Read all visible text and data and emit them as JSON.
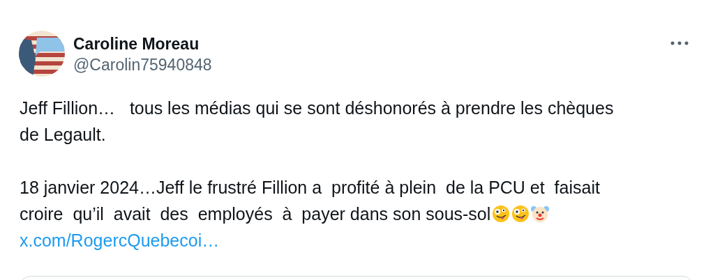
{
  "author": {
    "name": "Caroline Moreau",
    "handle": "@Carolin75940848"
  },
  "paragraphs": [
    {
      "lines": [
        "Jeff Fillion…   tous les médias qui se sont déshonorés à prendre les chèques",
        "de Legault."
      ]
    },
    {
      "lines": [
        "18 janvier 2024…Jeff le frustré Fillion a  profité à plein  de la PCU et  faisait",
        "croire  qu’il  avait  des  employés  à  payer dans son sous-sol"
      ]
    }
  ],
  "emojis": [
    {
      "kind": "zany"
    },
    {
      "kind": "zany"
    },
    {
      "kind": "clown"
    }
  ],
  "link": "x.com/RogercQuebecoi…"
}
